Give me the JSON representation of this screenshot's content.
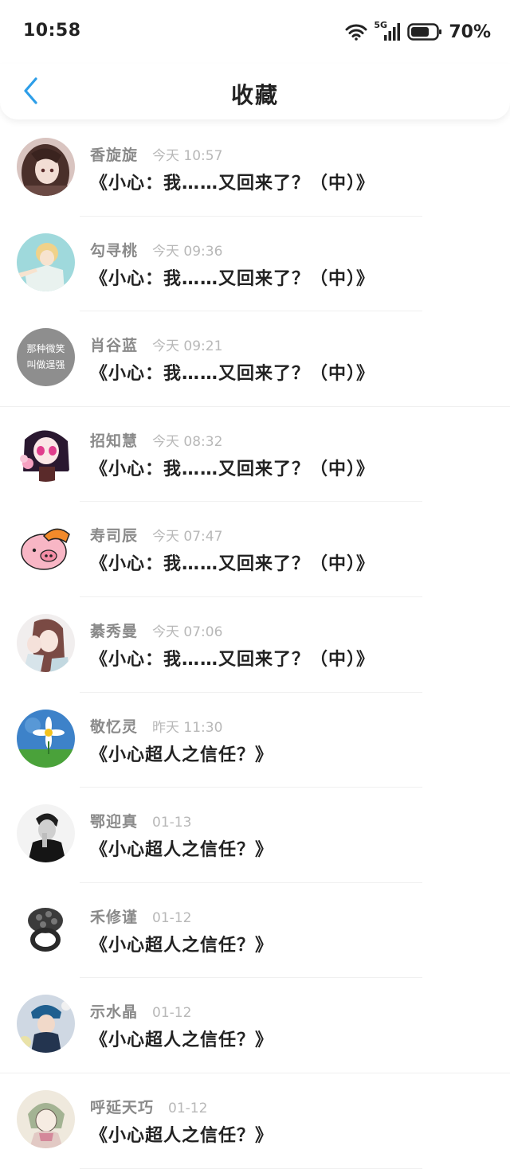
{
  "status_bar": {
    "time": "10:58",
    "network": "5G",
    "battery": "70%"
  },
  "header": {
    "title": "收藏",
    "back_icon": "chevron-left-icon",
    "accent_color": "#2d9ee8"
  },
  "items": [
    {
      "user": "香旋旋",
      "time": "今天 10:57",
      "title": "《小心：我……又回来了？（中）》",
      "avatar": "anime-girl-brown-hair"
    },
    {
      "user": "勾寻桃",
      "time": "今天 09:36",
      "title": "《小心：我……又回来了？（中）》",
      "avatar": "anime-boy-blonde"
    },
    {
      "user": "肖谷蓝",
      "time": "今天 09:21",
      "title": "《小心：我……又回来了？（中）》",
      "avatar": "text-grey",
      "avatar_text": [
        "那种微笑",
        "叫做逞强"
      ]
    },
    {
      "user": "招知慧",
      "time": "今天 08:32",
      "title": "《小心：我……又回来了？（中）》",
      "avatar": "anime-girl-dark-hair"
    },
    {
      "user": "寿司辰",
      "time": "今天 07:47",
      "title": "《小心：我……又回来了？（中）》",
      "avatar": "pink-pig"
    },
    {
      "user": "綦秀曼",
      "time": "今天 07:06",
      "title": "《小心：我……又回来了？（中）》",
      "avatar": "anime-couple"
    },
    {
      "user": "敬忆灵",
      "time": "昨天 11:30",
      "title": "《小心超人之信任？》",
      "avatar": "daisy-sky"
    },
    {
      "user": "鄂迎真",
      "time": "01-13",
      "title": "《小心超人之信任？》",
      "avatar": "bw-man"
    },
    {
      "user": "禾修谨",
      "time": "01-12",
      "title": "《小心超人之信任？》",
      "avatar": "skull-ring"
    },
    {
      "user": "示水晶",
      "time": "01-12",
      "title": "《小心超人之信任？》",
      "avatar": "girl-blue-hat"
    },
    {
      "user": "呼延天巧",
      "time": "01-12",
      "title": "《小心超人之信任？》",
      "avatar": "sketch-girl"
    }
  ]
}
